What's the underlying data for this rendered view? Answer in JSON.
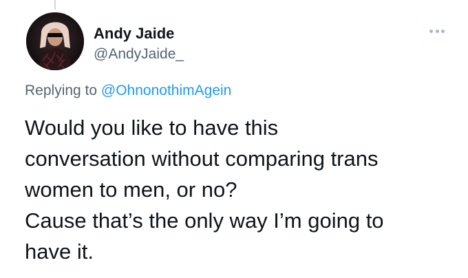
{
  "tweet": {
    "author": {
      "display_name": "Andy Jaide",
      "handle": "@AndyJaide_",
      "avatar_icon": "profile-photo"
    },
    "more_icon": "more-horizontal-icon",
    "replying_to": {
      "prefix": "Replying to",
      "handle": "@OhnonothimAgein"
    },
    "text_lines": [
      "Would you like to have this",
      "conversation without comparing trans",
      "women to men, or no?",
      "Cause that’s the only way I’m going to",
      "have it."
    ]
  },
  "colors": {
    "text_primary": "#0f1419",
    "text_secondary": "#536471",
    "link": "#1d9bf0",
    "more_dots": "#aab8c2",
    "thread_line": "#cfd9de"
  }
}
